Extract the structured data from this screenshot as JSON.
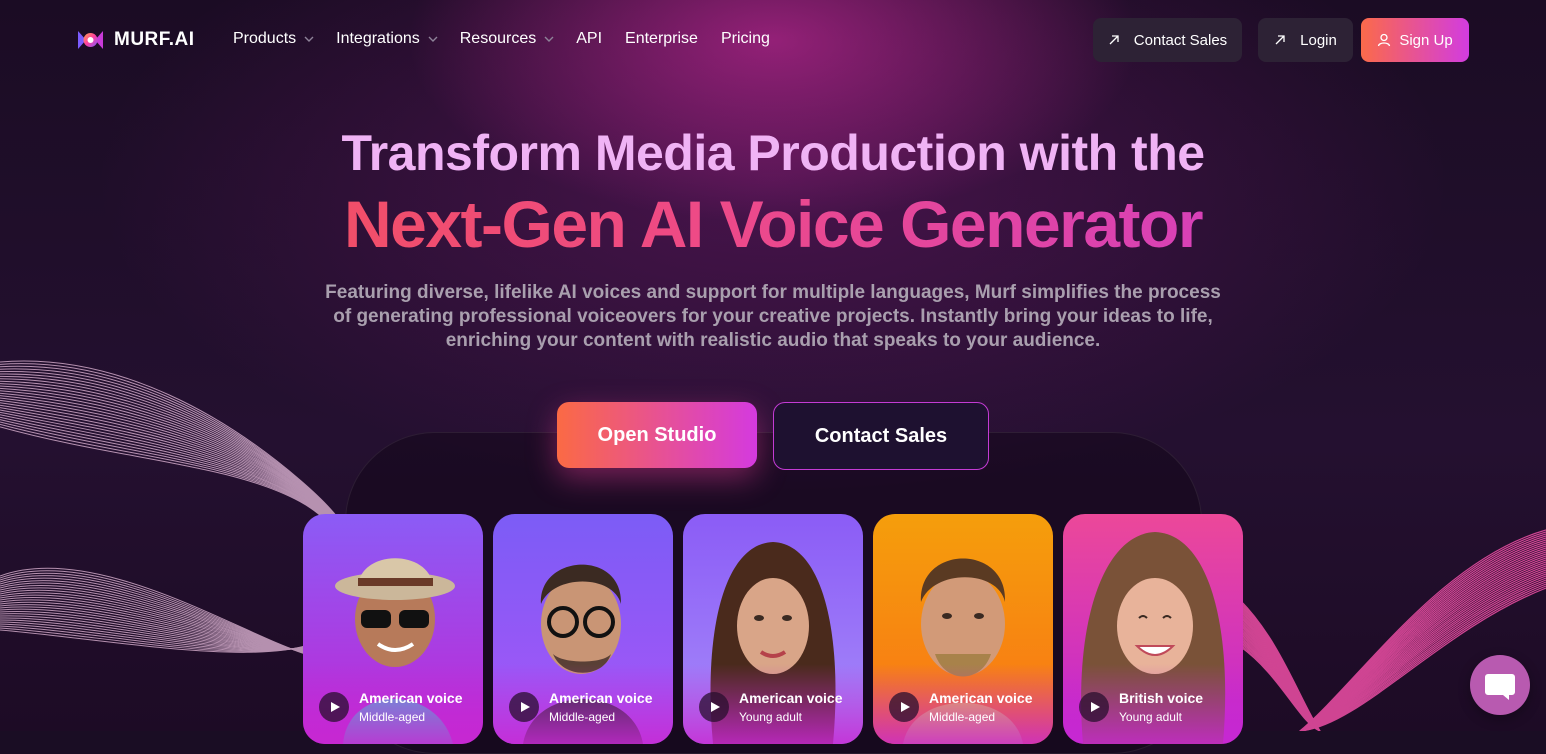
{
  "brand": {
    "name": "MURF.AI"
  },
  "nav": {
    "items": [
      {
        "label": "Products",
        "dropdown": true
      },
      {
        "label": "Integrations",
        "dropdown": true
      },
      {
        "label": "Resources",
        "dropdown": true
      },
      {
        "label": "API",
        "dropdown": false
      },
      {
        "label": "Enterprise",
        "dropdown": false
      },
      {
        "label": "Pricing",
        "dropdown": false
      }
    ],
    "contact_sales": "Contact Sales",
    "login": "Login",
    "signup": "Sign Up"
  },
  "hero": {
    "title_line1": "Transform Media Production with the",
    "title_line2": "Next-Gen AI Voice Generator",
    "description": "Featuring diverse, lifelike AI voices and support for multiple languages, Murf simplifies the process of generating professional voiceovers for your creative projects. Instantly bring your ideas to life, enriching your content with realistic audio that speaks to your audience.",
    "cta_primary": "Open Studio",
    "cta_secondary": "Contact Sales"
  },
  "voices": [
    {
      "name": "American voice",
      "age": "Middle-aged",
      "bg": [
        "#8b5cf6",
        "#c026d3"
      ]
    },
    {
      "name": "American voice",
      "age": "Middle-aged",
      "bg": [
        "#7c5cf6",
        "#a855f7"
      ]
    },
    {
      "name": "American voice",
      "age": "Young adult",
      "bg": [
        "#8b5cf6",
        "#a78bfa"
      ]
    },
    {
      "name": "American voice",
      "age": "Middle-aged",
      "bg": [
        "#f59e0b",
        "#f97316"
      ]
    },
    {
      "name": "British voice",
      "age": "Young adult",
      "bg": [
        "#ec4899",
        "#c026d3"
      ]
    }
  ],
  "colors": {
    "accent_start": "#fb6a44",
    "accent_end": "#d43adf",
    "title_pink": "#f0b3f5",
    "background": "#1a0d24"
  }
}
